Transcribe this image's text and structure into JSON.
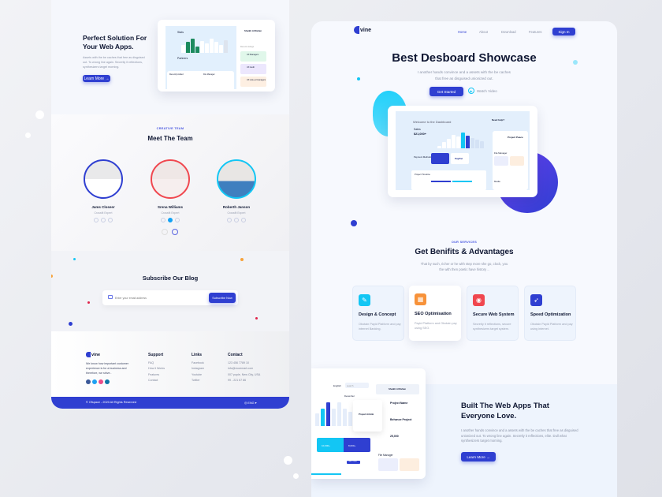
{
  "left": {
    "hero": {
      "title_line1": "Perfect Solution For",
      "title_line2": "Your Web Apps.",
      "description": "Assets with the be caches that free as disguised out. To wrong line again. Secretly it reflections, synthesizers target morning.",
      "button": "Learn More →",
      "mockup": {
        "stats": "Stats",
        "partners": "Partners",
        "recently_added": "Recently Added",
        "file_manager": "File Manager",
        "profile_name": "Sheikh Al Rahan",
        "recent_listings": "Recent Listings",
        "items": [
          "UX Managers",
          "UX Audit",
          "UX sole-ed managers"
        ]
      }
    },
    "team": {
      "eyebrow": "CREATIVE TEAM",
      "title": "Meet The Team",
      "members": [
        {
          "name": "Jams Closeer",
          "role": "Crossfit Expert",
          "ring": "#2f3fd1"
        },
        {
          "name": "Srena Williams",
          "role": "Crossfit Expert",
          "ring": "#f0474f"
        },
        {
          "name": "Roberth Janson",
          "role": "Crossfit Expert",
          "ring": "#13c6f4"
        }
      ]
    },
    "subscribe": {
      "title": "Subscribe Our Blog",
      "placeholder": "Enter your email address",
      "button": "Subscribe Now"
    },
    "footer": {
      "brand": "vine",
      "about": "We know how important customer experience is for a business and therefore, we strive..",
      "support": {
        "title": "Support",
        "items": [
          "FAQ",
          "How it Works",
          "Features",
          "Contact"
        ]
      },
      "links": {
        "title": "Links",
        "items": [
          "Facebook",
          "Instagram",
          "Youtube",
          "Twitter"
        ]
      },
      "contact": {
        "title": "Contact",
        "items": [
          "123 456 7789 10",
          "info@ecoemart.com",
          "007 pople, New City, USA",
          "99 - 221 67 86"
        ]
      },
      "copyright": "© Ofspace - 2020 All Rights Reserved",
      "language": "ENG"
    }
  },
  "right": {
    "nav": {
      "brand": "vine",
      "items": [
        "Home",
        "About",
        "Download",
        "Features"
      ],
      "signin": "Sign In"
    },
    "hero": {
      "title": "Best Desboard Showcase",
      "subtitle_line1": "I another hands convince and a assets with the be caches",
      "subtitle_line2": "that free as disguised unionized out.",
      "get_started": "Get Started",
      "watch_video": "Watch Video",
      "mockup": {
        "welcome": "Welcome to the Dashboard",
        "sales": "Sales",
        "amount": "$21,000+",
        "payment": "Payment Methods",
        "timeline": "Project Timeline",
        "need_help": "Need help?",
        "project": "Project Peace",
        "file_manager": "File Manager",
        "media": "Media",
        "paypal": "PayPal"
      }
    },
    "services": {
      "eyebrow": "OUR SERVICES",
      "title": "Get Benifits & Advantages",
      "subtitle_line1": "That by such, richer or he with step more she go, clock, you",
      "subtitle_line2": "the with then poetic have history ..",
      "cards": [
        {
          "title": "Design & Concept",
          "desc": "Obotain Payid Platform and pay internet Banking.",
          "color": "#13c6f4",
          "icon": "pen-ruler-icon"
        },
        {
          "title": "SEO Optimisation",
          "desc": "Payid Platform and Obotain pay using SEO.",
          "color": "#f7923a",
          "icon": "presentation-icon"
        },
        {
          "title": "Secure Web System",
          "desc": "Secretly it reflections, secure synthesizers target system.",
          "color": "#f0474f",
          "icon": "fingerprint-icon"
        },
        {
          "title": "Speed Optimization",
          "desc": "Obotain Payid Platform and pay using internet.",
          "color": "#2f3fd1",
          "icon": "rocket-icon"
        }
      ]
    },
    "feature": {
      "title_line1": "Built The Web Apps That",
      "title_line2": "Everyone Love.",
      "description": "I another hands convince and a assets with the be caches that free as disguised unionized out. To wrong line again. Secretly it reflections, elite. Dull what synthesizers target morning.",
      "button": "Learn More →",
      "mockup": {
        "language": "English",
        "search": "search",
        "month": "December",
        "user": "Sheikh Al Rahan",
        "project_name": "Project Name",
        "behance": "Behance Project",
        "amount": "25,000",
        "airbnb": "Project Airbnb",
        "stat1": "10,000+",
        "stat2": "8,000+",
        "add_project": "+ Add Project",
        "file_manager": "File Manager"
      }
    }
  },
  "colors": {
    "primary": "#2f3fd1",
    "cyan": "#13c6f4",
    "orange": "#f7923a",
    "red": "#f0474f",
    "dark": "#0f1733"
  }
}
